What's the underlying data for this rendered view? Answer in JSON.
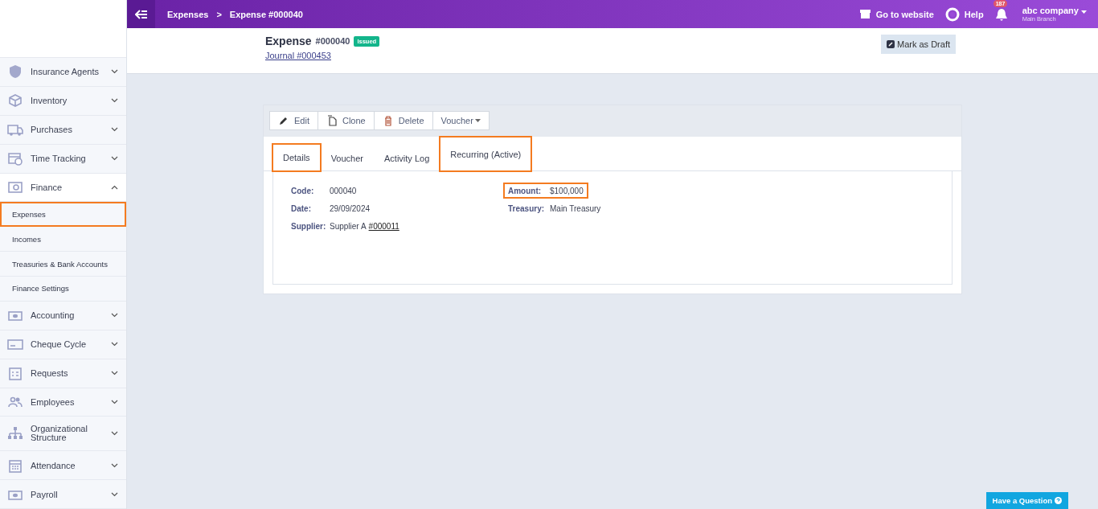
{
  "topbar": {
    "breadcrumbs": [
      "Expenses",
      "Expense #000040"
    ],
    "breadcrumb_separator": ">",
    "website_link": "Go to website",
    "help_link": "Help",
    "notification_count": "187",
    "company": "abc company",
    "branch": "Main Branch"
  },
  "sidebar": {
    "items": [
      {
        "label": "Insurance Agents",
        "expanded": false
      },
      {
        "label": "Inventory",
        "expanded": false
      },
      {
        "label": "Purchases",
        "expanded": false
      },
      {
        "label": "Time Tracking",
        "expanded": false
      },
      {
        "label": "Finance",
        "expanded": true,
        "children": [
          {
            "label": "Expenses",
            "highlighted": true
          },
          {
            "label": "Incomes",
            "highlighted": false
          },
          {
            "label": "Treasuries & Bank Accounts",
            "highlighted": false
          },
          {
            "label": "Finance Settings",
            "highlighted": false
          }
        ]
      },
      {
        "label": "Accounting",
        "expanded": false
      },
      {
        "label": "Cheque Cycle",
        "expanded": false
      },
      {
        "label": "Requests",
        "expanded": false
      },
      {
        "label": "Employees",
        "expanded": false
      },
      {
        "label": "Organizational Structure",
        "expanded": false
      },
      {
        "label": "Attendance",
        "expanded": false
      },
      {
        "label": "Payroll",
        "expanded": false
      }
    ]
  },
  "header": {
    "title": "Expense",
    "number": "#000040",
    "status": "Issued",
    "journal_link": "Journal #000453",
    "action_button": "Mark as Draft"
  },
  "toolbar": {
    "buttons": [
      {
        "label": "Edit",
        "kind": "button"
      },
      {
        "label": "Clone",
        "kind": "button"
      },
      {
        "label": "Delete",
        "kind": "button"
      },
      {
        "label": "Voucher",
        "kind": "dropdown"
      }
    ]
  },
  "tabs": [
    {
      "label": "Details",
      "selected": true,
      "highlighted": true
    },
    {
      "label": "Voucher",
      "selected": false,
      "highlighted": false
    },
    {
      "label": "Activity Log",
      "selected": false,
      "highlighted": false
    },
    {
      "label": "Recurring (Active)",
      "selected": false,
      "highlighted": true
    }
  ],
  "details": {
    "columns": [
      [
        {
          "label": "Code:",
          "value": "000040",
          "highlighted": false
        },
        {
          "label": "Date:",
          "value": "29/09/2024",
          "highlighted": false
        },
        {
          "label": "Supplier:",
          "value": "Supplier A",
          "link": "#000011",
          "highlighted": false
        }
      ],
      [
        {
          "label": "Amount:",
          "value": "$100,000",
          "highlighted": true
        },
        {
          "label": "Treasury:",
          "value": "Main Treasury",
          "highlighted": false
        }
      ]
    ]
  },
  "help_button": "Have a Question"
}
